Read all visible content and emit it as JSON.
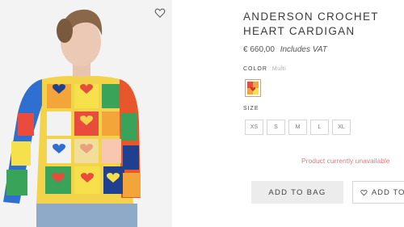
{
  "product": {
    "title": "ANDERSON CROCHET HEART CARDIGAN",
    "price": "€ 660,00",
    "price_note": "Includes VAT"
  },
  "color": {
    "label": "COLOR",
    "selected": "Multi"
  },
  "size": {
    "label": "SIZE",
    "options": [
      "XS",
      "S",
      "M",
      "L",
      "XL"
    ]
  },
  "status": {
    "availability": "Product currently unavailable"
  },
  "actions": {
    "add_to_bag": "ADD TO BAG",
    "add_to_wishlist": "ADD TO W"
  },
  "icons": {
    "favorite": "heart-outline-icon",
    "wishlist": "heart-outline-icon"
  },
  "colors": {
    "unavailable_text": "#d87f7f",
    "swatch_border": "#c9a57d"
  }
}
